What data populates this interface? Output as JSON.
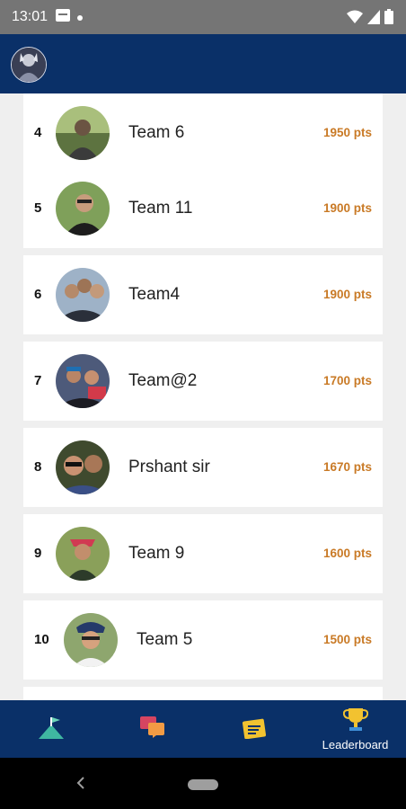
{
  "status_bar": {
    "time": "13:01",
    "icons": [
      "notification-icon",
      "dot-icon",
      "wifi-icon",
      "signal-icon",
      "battery-icon"
    ]
  },
  "app_bar": {
    "avatar": "profile-avatar"
  },
  "leaderboard": {
    "entries": [
      {
        "rank": "4",
        "name": "Team 6",
        "points": "1950 pts"
      },
      {
        "rank": "5",
        "name": "Team 11",
        "points": "1900 pts"
      },
      {
        "rank": "6",
        "name": "Team4",
        "points": "1900 pts"
      },
      {
        "rank": "7",
        "name": "Team@2",
        "points": "1700 pts"
      },
      {
        "rank": "8",
        "name": "Prshant sir",
        "points": "1670 pts"
      },
      {
        "rank": "9",
        "name": "Team 9",
        "points": "1600 pts"
      },
      {
        "rank": "10",
        "name": "Team 5",
        "points": "1500 pts"
      }
    ]
  },
  "bottom_nav": {
    "items": [
      {
        "icon": "flag-mountain-icon",
        "label": ""
      },
      {
        "icon": "chat-icon",
        "label": ""
      },
      {
        "icon": "notes-icon",
        "label": ""
      },
      {
        "icon": "trophy-icon",
        "label": "Leaderboard"
      }
    ]
  },
  "colors": {
    "primary": "#0a3068",
    "points": "#c97a26",
    "status_bar": "#757575"
  }
}
